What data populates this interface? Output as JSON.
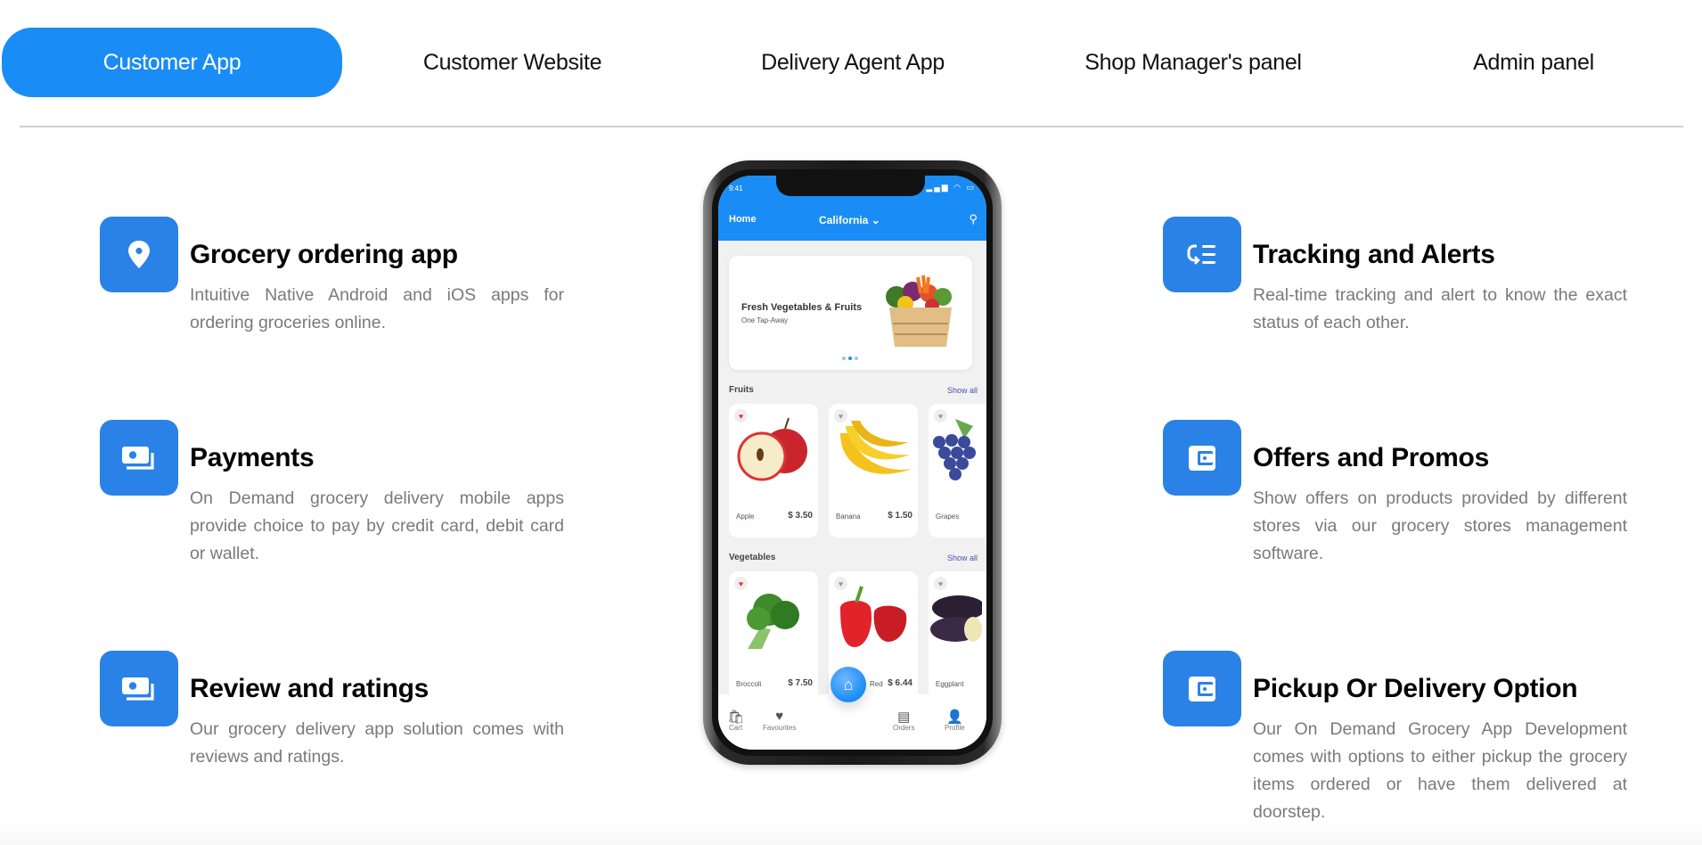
{
  "tabs": [
    {
      "label": "Customer App",
      "active": true
    },
    {
      "label": "Customer Website",
      "active": false
    },
    {
      "label": "Delivery Agent App",
      "active": false
    },
    {
      "label": "Shop Manager's panel",
      "active": false
    },
    {
      "label": "Admin panel",
      "active": false
    }
  ],
  "features_left": [
    {
      "icon": "location-pin-icon",
      "title": "Grocery ordering app",
      "description": "Intuitive Native Android and iOS apps for ordering groceries online."
    },
    {
      "icon": "money-icon",
      "title": "Payments",
      "description": "On Demand grocery delivery mobile apps provide choice to pay by credit card, debit card or wallet."
    },
    {
      "icon": "money-icon",
      "title": "Review and ratings",
      "description": "Our grocery delivery app solution comes with reviews and ratings."
    }
  ],
  "features_right": [
    {
      "icon": "tracking-list-icon",
      "title": "Tracking and Alerts",
      "description": "Real-time tracking and alert to know the exact status of each other."
    },
    {
      "icon": "wallet-icon",
      "title": "Offers and Promos",
      "description": "Show offers on products provided by different stores via our grocery stores management software."
    },
    {
      "icon": "wallet-icon",
      "title": "Pickup Or Delivery Option",
      "description": "Our On Demand Grocery App Development comes with options to either pickup the grocery items ordered or have them delivered at doorstep."
    }
  ],
  "phone": {
    "status_time": "9:41",
    "home_label": "Home",
    "location": "California",
    "banner_title": "Fresh Vegetables & Fruits",
    "banner_subtitle": "One Tap-Away",
    "fruits_title": "Fruits",
    "vegetables_title": "Vegetables",
    "show_all": "Show all",
    "fruits": [
      {
        "name": "Apple",
        "price": "$ 3.50",
        "favourite": true
      },
      {
        "name": "Banana",
        "price": "$ 1.50",
        "favourite": false
      },
      {
        "name": "Grapes",
        "price": "",
        "favourite": false
      }
    ],
    "vegetables": [
      {
        "name": "Broccoli",
        "price": "$ 7.50",
        "favourite": true
      },
      {
        "name": "Red",
        "price": "$ 6.44",
        "favourite": false
      },
      {
        "name": "Eggplant",
        "price": "",
        "favourite": false
      }
    ],
    "nav": [
      "Cart",
      "Favourites",
      "Orders",
      "Profile"
    ]
  },
  "colors": {
    "accent": "#1a8cf5",
    "icon_bg": "#2a82e6"
  }
}
